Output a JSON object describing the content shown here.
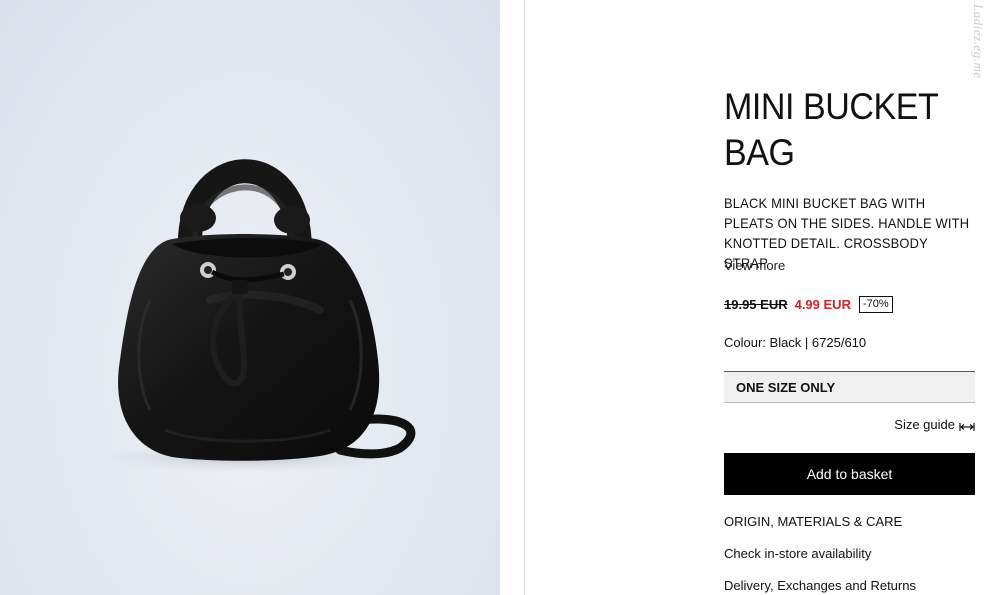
{
  "product": {
    "image_alt": "Black mini bucket bag",
    "title": "MINI BUCKET BAG",
    "description": "BLACK MINI BUCKET BAG WITH PLEATS ON THE SIDES. HANDLE WITH KNOTTED DETAIL. CROSSBODY STRAP",
    "view_more": "View more",
    "old_price": "19.95 EUR",
    "new_price": "4.99 EUR",
    "discount": "-70%",
    "colour": "Colour: Black | 6725/610",
    "size_option": "ONE SIZE ONLY",
    "size_guide": "Size guide",
    "add_to_basket": "Add to basket"
  },
  "links": {
    "origin": "ORIGIN, MATERIALS & CARE",
    "availability": "Check in-store availability",
    "delivery": "Delivery, Exchanges and Returns"
  },
  "watermark": "Ladiez.eg.me",
  "colors": {
    "accent_price": "#d1232a",
    "button_bg": "#000000",
    "photo_bg": "#e3e7ef"
  }
}
